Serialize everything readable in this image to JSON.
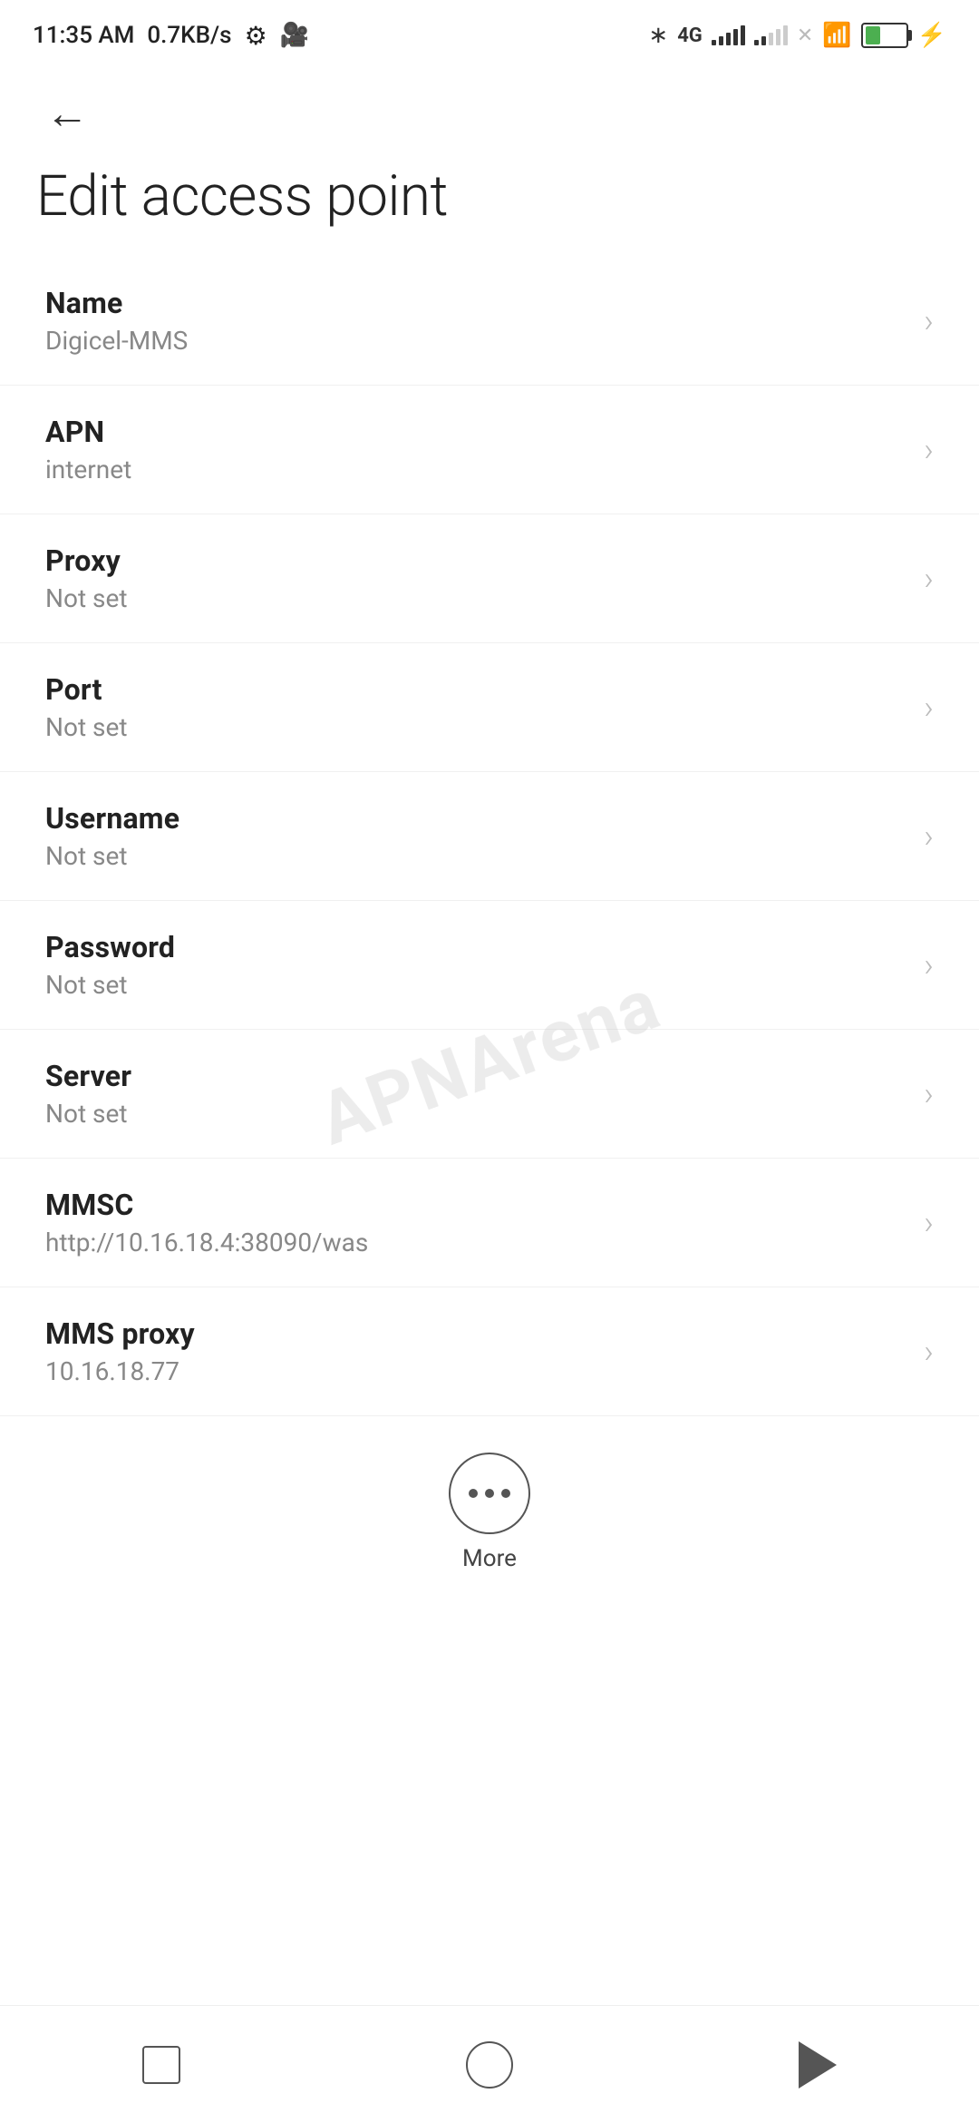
{
  "statusBar": {
    "time": "11:35 AM",
    "speed": "0.7KB/s",
    "battery": 38
  },
  "header": {
    "backLabel": "←",
    "title": "Edit access point"
  },
  "settings": {
    "items": [
      {
        "label": "Name",
        "value": "Digicel-MMS"
      },
      {
        "label": "APN",
        "value": "internet"
      },
      {
        "label": "Proxy",
        "value": "Not set"
      },
      {
        "label": "Port",
        "value": "Not set"
      },
      {
        "label": "Username",
        "value": "Not set"
      },
      {
        "label": "Password",
        "value": "Not set"
      },
      {
        "label": "Server",
        "value": "Not set"
      },
      {
        "label": "MMSC",
        "value": "http://10.16.18.4:38090/was"
      },
      {
        "label": "MMS proxy",
        "value": "10.16.18.77"
      }
    ]
  },
  "more": {
    "label": "More"
  },
  "watermark": "APNArena"
}
